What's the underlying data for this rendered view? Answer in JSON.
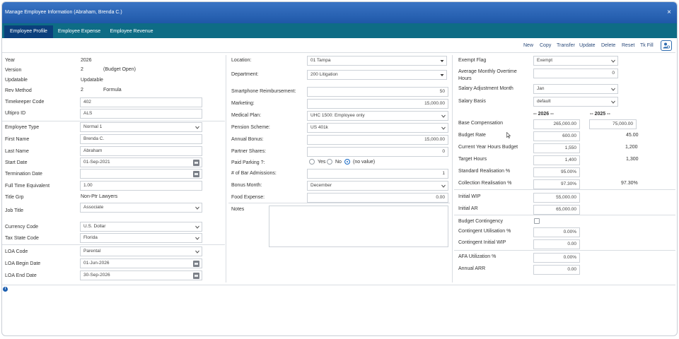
{
  "window": {
    "title": "Manage Employee Information (Abraham, Brenda C.)",
    "close_glyph": "×"
  },
  "tabs": [
    {
      "label": "Employee Profile",
      "active": true
    },
    {
      "label": "Employee Expense",
      "active": false
    },
    {
      "label": "Employee Revenue",
      "active": false
    }
  ],
  "toolbar": {
    "new": "New",
    "copy": "Copy",
    "transfer": "Transfer",
    "update": "Update",
    "delete": "Delete",
    "reset": "Reset",
    "tk_fill": "Tk Fill",
    "user_icon": "user-settings-icon"
  },
  "col1": {
    "year": {
      "label": "Year",
      "value": "2026"
    },
    "version": {
      "label": "Version",
      "value": "2",
      "note": "(Budget Open)"
    },
    "updatable": {
      "label": "Updatable",
      "value": "Updatable"
    },
    "rev_method": {
      "label": "Rev Method",
      "value": "2",
      "note": "Formula"
    },
    "timekeeper_code": {
      "label": "Timekeeper Code",
      "value": "402"
    },
    "ultipro_id": {
      "label": "Ultipro ID",
      "value": "ALS"
    },
    "employee_type": {
      "label": "Employee Type",
      "value": "Normal 1"
    },
    "first_name": {
      "label": "First Name",
      "value": "Brenda C."
    },
    "last_name": {
      "label": "Last Name",
      "value": "Abraham"
    },
    "start_date": {
      "label": "Start Date",
      "value": "01-Sep-2021"
    },
    "termination_date": {
      "label": "Termination Date",
      "value": ""
    },
    "fte": {
      "label": "Full Time Equivalent",
      "value": "1.00"
    },
    "title_grp": {
      "label": "Title Grp",
      "value": "Non-Ptr Lawyers"
    },
    "job_title": {
      "label": "Job Title",
      "value": "Associate"
    },
    "currency_code": {
      "label": "Currency Code",
      "value": "U.S. Dollar"
    },
    "tax_state_code": {
      "label": "Tax State Code",
      "value": "Florida"
    },
    "loa_code": {
      "label": "LOA Code",
      "value": "Parental"
    },
    "loa_begin": {
      "label": "LOA Begin Date",
      "value": "01-Jun-2026"
    },
    "loa_end": {
      "label": "LOA End Date",
      "value": "30-Sep-2026"
    }
  },
  "col2": {
    "location": {
      "label": "Location:",
      "value": "01 Tampa"
    },
    "department": {
      "label": "Department:",
      "value": "200 Litigation"
    },
    "smartphone": {
      "label": "Smartphone Reimbursement:",
      "value": "50"
    },
    "marketing": {
      "label": "Marketing:",
      "value": "15,000.00"
    },
    "medical_plan": {
      "label": "Medical Plan:",
      "value": "UHC 1500: Employee only"
    },
    "pension_scheme": {
      "label": "Pension Scheme:",
      "value": "US 401k"
    },
    "annual_bonus": {
      "label": "Annual Bonus:",
      "value": "15,000.00"
    },
    "partner_shares": {
      "label": "Partner Shares:",
      "value": "0"
    },
    "paid_parking": {
      "label": "Paid Parking ?:",
      "opt_yes": "Yes",
      "opt_no": "No",
      "opt_none": "(no value)",
      "selected": "(no value)"
    },
    "bar_admissions": {
      "label": "# of Bar Admissions:",
      "value": "1"
    },
    "bonus_month": {
      "label": "Bonus Month:",
      "value": "December"
    },
    "food_expense": {
      "label": "Food Expense:",
      "value": "0.00"
    },
    "notes": {
      "label": "Notes",
      "value": ""
    }
  },
  "col3": {
    "exempt_flag": {
      "label": "Exempt Flag",
      "value": "Exempt"
    },
    "avg_overtime": {
      "label1": "Average Monthly Overtime",
      "label2": "Hours",
      "value": "0"
    },
    "salary_adj_month": {
      "label": "Salary Adjustment Month",
      "value": "Jan"
    },
    "salary_basis": {
      "label": "Salary Basis",
      "value": "default"
    },
    "year_headers": {
      "current": "-- 2026 --",
      "prior": "-- 2025 --"
    },
    "base_comp": {
      "label": "Base Compensation",
      "current": "265,000.00",
      "prior": "75,000.00"
    },
    "budget_rate": {
      "label": "Budget Rate",
      "current": "600.00",
      "prior": "45.00"
    },
    "cy_hours_budget": {
      "label": "Current Year Hours Budget",
      "current": "1,550",
      "prior": "1,200"
    },
    "target_hours": {
      "label": "Target Hours",
      "current": "1,400",
      "prior": "1,300"
    },
    "std_realisation": {
      "label": "Standard Realisation %",
      "current": "95.00%"
    },
    "coll_realisation": {
      "label": "Collection Realisation %",
      "current": "97.30%",
      "prior": "97.30%"
    },
    "initial_wip": {
      "label": "Initial WIP",
      "value": "55,000.00"
    },
    "initial_ar": {
      "label": "Initial AR",
      "value": "65,000.00"
    },
    "budget_contingency": {
      "label": "Budget Contingency"
    },
    "contingent_util": {
      "label": "Contingent Utilisation %",
      "value": "0.00%"
    },
    "contingent_wip": {
      "label": "Contingent Initial WIP",
      "value": "0.00"
    },
    "afa_util": {
      "label": "AFA Utilization %",
      "value": "0.00%"
    },
    "annual_arr": {
      "label": "Annual ARR",
      "value": "0.00"
    }
  },
  "footer": {
    "info_glyph": "i"
  }
}
